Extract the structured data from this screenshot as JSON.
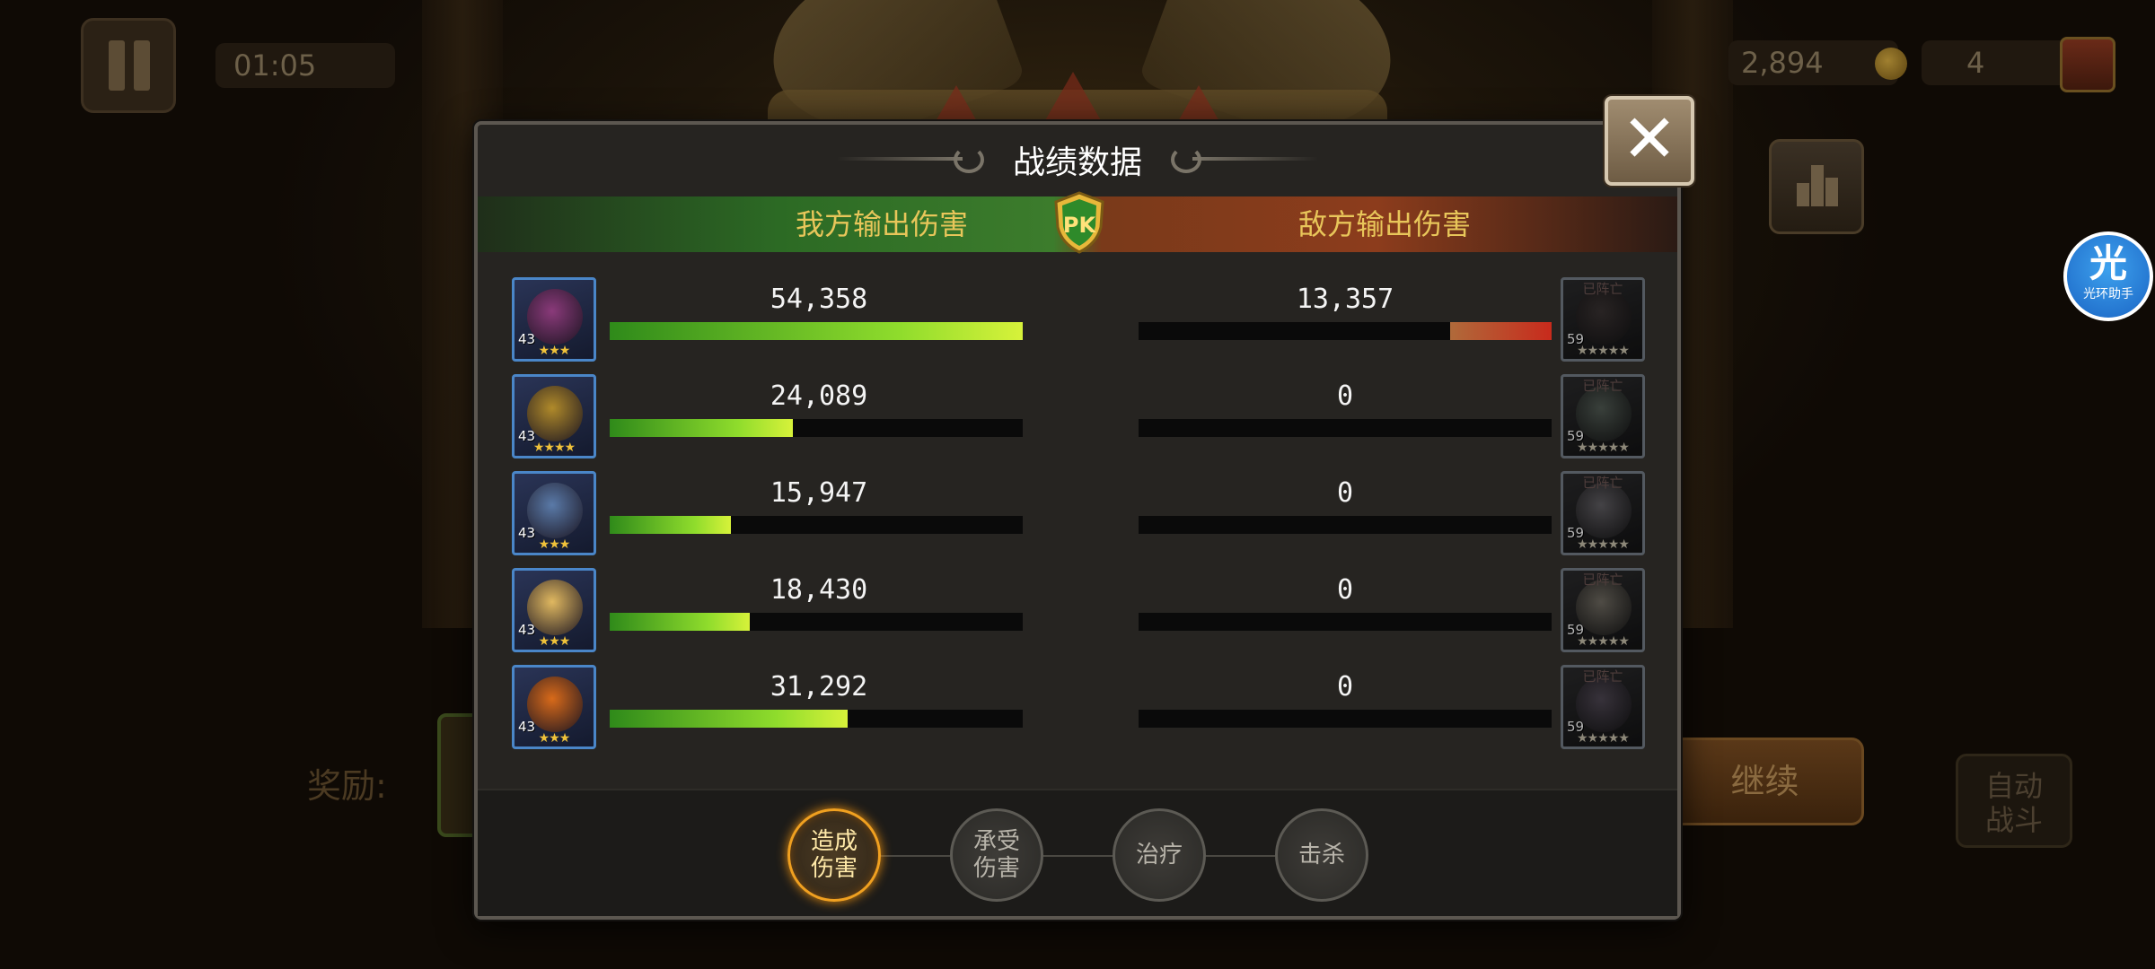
{
  "hud": {
    "timer": "01:05",
    "gold": "2,894",
    "chest_count": "4",
    "reward_label": "奖励:",
    "continue_label": "继续",
    "auto_battle_label_line1": "自动",
    "auto_battle_label_line2": "战斗",
    "assistant_badge_big": "光",
    "assistant_badge_small": "光环助手"
  },
  "modal": {
    "title": "战绩数据",
    "ally_header": "我方输出伤害",
    "enemy_header": "敌方输出伤害",
    "pk_label": "PK",
    "close_symbol": "✕",
    "max_value": 54358,
    "rows": [
      {
        "ally": {
          "value": "54,358",
          "num": 54358,
          "level": "43",
          "stars": "★★★",
          "color": "#8a3a7a"
        },
        "enemy": {
          "value": "13,357",
          "num": 13357,
          "level": "59",
          "stars": "★★★★★",
          "status": "已阵亡",
          "color": "#5a2a2a"
        }
      },
      {
        "ally": {
          "value": "24,089",
          "num": 24089,
          "level": "43",
          "stars": "★★★★",
          "color": "#b08a2a"
        },
        "enemy": {
          "value": "0",
          "num": 0,
          "level": "59",
          "stars": "★★★★★",
          "status": "已阵亡",
          "color": "#2a6a3a"
        }
      },
      {
        "ally": {
          "value": "15,947",
          "num": 15947,
          "level": "43",
          "stars": "★★★",
          "color": "#5a7aa8"
        },
        "enemy": {
          "value": "0",
          "num": 0,
          "level": "59",
          "stars": "★★★★★",
          "status": "已阵亡",
          "color": "#6a5a7a"
        }
      },
      {
        "ally": {
          "value": "18,430",
          "num": 18430,
          "level": "43",
          "stars": "★★★",
          "color": "#e0b860"
        },
        "enemy": {
          "value": "0",
          "num": 0,
          "level": "59",
          "stars": "★★★★★",
          "status": "已阵亡",
          "color": "#8a6a2a"
        }
      },
      {
        "ally": {
          "value": "31,292",
          "num": 31292,
          "level": "43",
          "stars": "★★★",
          "color": "#d86a1a"
        },
        "enemy": {
          "value": "0",
          "num": 0,
          "level": "59",
          "stars": "★★★★★",
          "status": "已阵亡",
          "color": "#6a3a8a"
        }
      }
    ],
    "tabs": [
      {
        "line1": "造成",
        "line2": "伤害",
        "active": true
      },
      {
        "line1": "承受",
        "line2": "伤害",
        "active": false
      },
      {
        "line1": "治疗",
        "line2": "",
        "active": false
      },
      {
        "line1": "击杀",
        "line2": "",
        "active": false
      }
    ]
  },
  "colors": {
    "accent_gold": "#e8c65a",
    "ally_band": "#3c7c2c",
    "enemy_band": "#8c3c1c",
    "active_tab_glow": "#f0a020"
  }
}
